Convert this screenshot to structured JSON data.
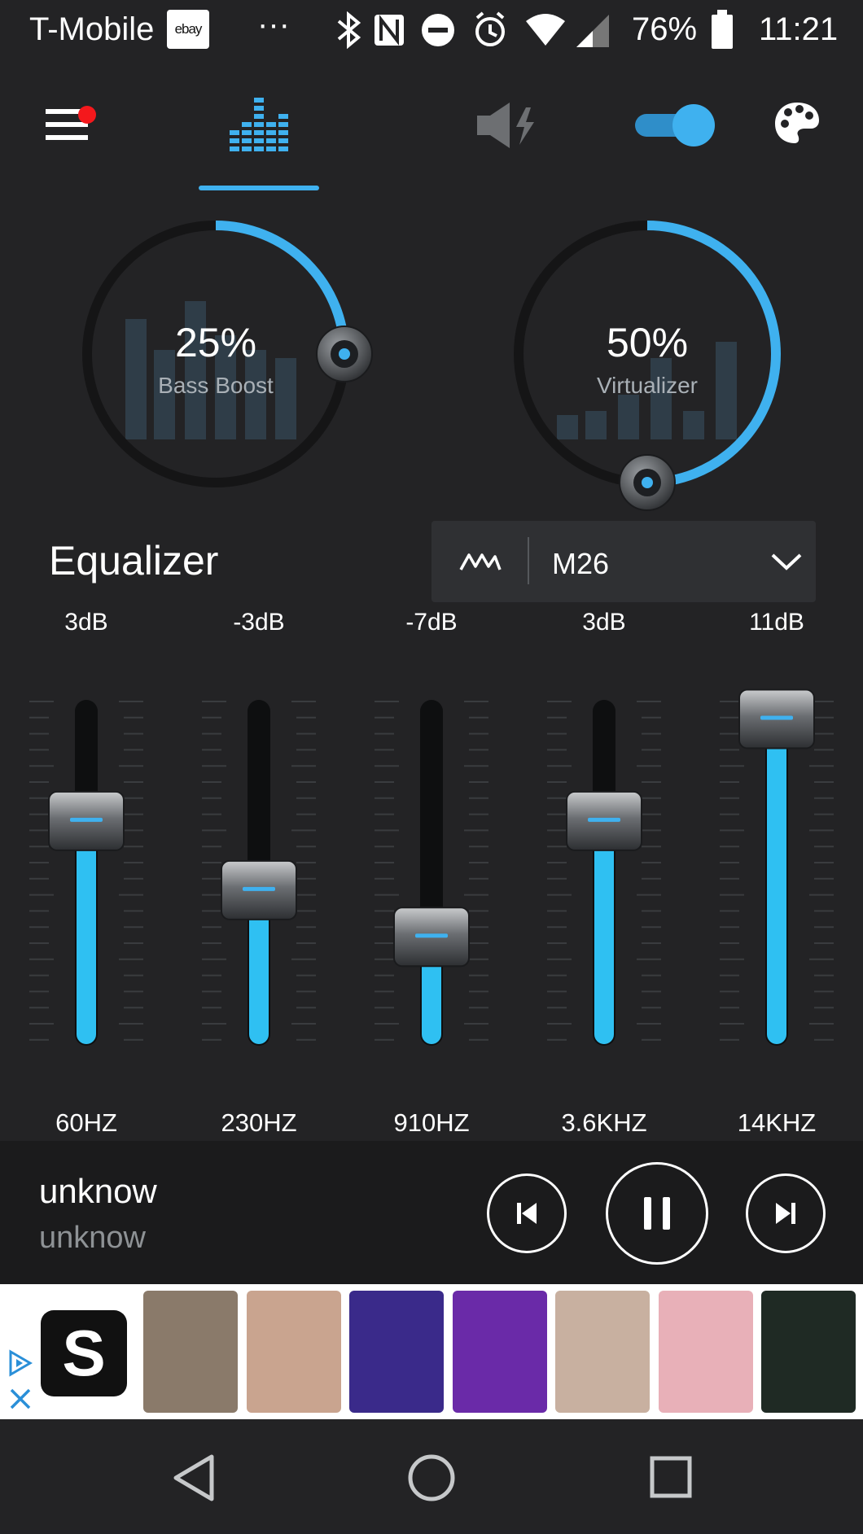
{
  "status_bar": {
    "carrier": "T-Mobile",
    "notification_badge": "ebay",
    "overflow": "···",
    "battery": "76%",
    "time": "11:21"
  },
  "toolbar": {
    "icons": [
      "menu-icon",
      "equalizer-icon",
      "speaker-boost-icon",
      "toggle-switch",
      "palette-icon"
    ],
    "active_tab": "equalizer",
    "toggle_on": true,
    "accent_color": "#3fb1ef"
  },
  "knobs": [
    {
      "value": "25%",
      "label": "Bass Boost",
      "level": 0.25
    },
    {
      "value": "50%",
      "label": "Virtualizer",
      "level": 0.5
    }
  ],
  "equalizer": {
    "title": "Equalizer",
    "preset": "M26",
    "bands": [
      {
        "gain": "3dB",
        "freq": "60HZ",
        "level": 0.645
      },
      {
        "gain": "-3dB",
        "freq": "230HZ",
        "level": 0.445
      },
      {
        "gain": "-7dB",
        "freq": "910HZ",
        "level": 0.31
      },
      {
        "gain": "3dB",
        "freq": "3.6KHZ",
        "level": 0.645
      },
      {
        "gain": "11dB",
        "freq": "14KHZ",
        "level": 0.94
      }
    ]
  },
  "player": {
    "title": "unknow",
    "artist": "unknow",
    "playing": true
  },
  "ad": {
    "brand_letter": "S",
    "thumbnails": [
      {
        "name": "ad-photo-jersey",
        "color": "#8a7a6a"
      },
      {
        "name": "ad-photo-portrait",
        "color": "#c9a48f"
      },
      {
        "name": "ad-photo-disco",
        "color": "#3a2a8a"
      },
      {
        "name": "ad-photo-neon-heart",
        "color": "#6a2aa8"
      },
      {
        "name": "ad-photo-glasses",
        "color": "#c8b0a0"
      },
      {
        "name": "ad-photo-necklace",
        "color": "#e8b0b8"
      },
      {
        "name": "ad-photo-stars",
        "color": "#1f2a24"
      }
    ]
  },
  "nav": {
    "icons": [
      "back-icon",
      "home-icon",
      "recents-icon"
    ]
  }
}
